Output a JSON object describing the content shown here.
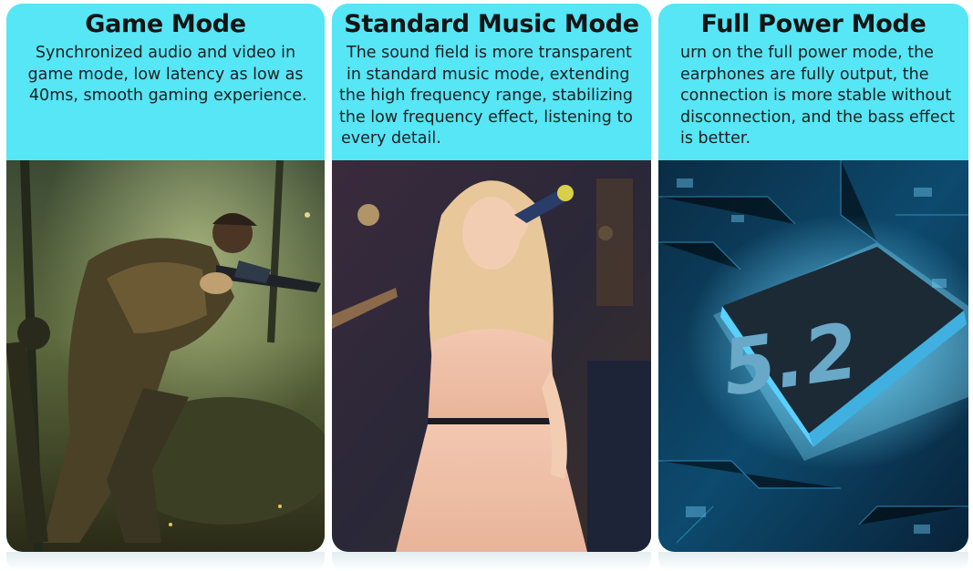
{
  "panels": [
    {
      "title": "Game Mode",
      "lines": [
        "Synchronized audio and video in",
        "game mode, low latency as low as",
        " 40ms, smooth gaming experience."
      ],
      "image": "soldier-game-scene"
    },
    {
      "title": "Standard Music Mode",
      "lines": [
        "The sound field is more transparent",
        "in standard music mode, extending",
        "the high frequency range, stabilizing",
        "the low frequency effect, listening to",
        "every detail."
      ],
      "image": "singer-with-microphone"
    },
    {
      "title": "Full Power Mode",
      "lines": [
        "urn on the full power mode, the",
        "earphones are fully output, the",
        "connection is more stable without",
        "disconnection, and the bass effect",
        "is better."
      ],
      "image": "bluetooth-chip-circuit-board",
      "chip_label": "5.2"
    }
  ],
  "colors": {
    "header_bg": "#56e6f6",
    "text": "#141414"
  }
}
